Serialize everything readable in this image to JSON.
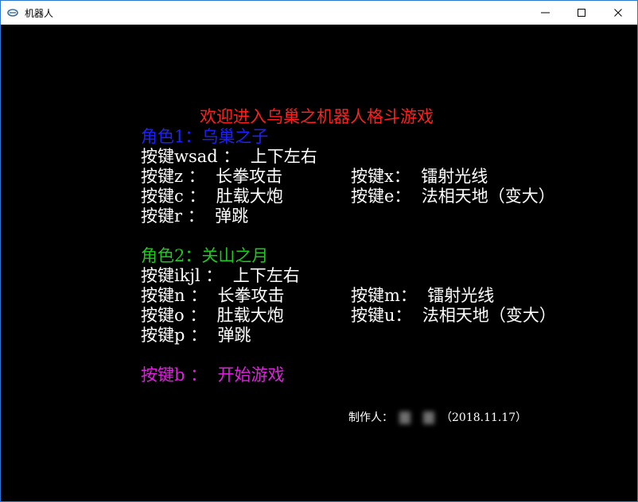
{
  "window": {
    "title": "机器人"
  },
  "console": {
    "title_line": "欢迎进入乌巢之机器人格斗游戏",
    "p1": {
      "name": "角色1：乌巢之子",
      "rows": [
        [
          "按键wsad ：  上下左右",
          ""
        ],
        [
          "按键z ：  长拳攻击",
          "按键x：  镭射光线"
        ],
        [
          "按键c ：  肚载大炮",
          "按键e：  法相天地（变大）"
        ],
        [
          "按键r ：  弹跳",
          ""
        ]
      ]
    },
    "p2": {
      "name": "角色2：关山之月",
      "rows": [
        [
          "按键ikjl ：  上下左右",
          ""
        ],
        [
          "按键n ：  长拳攻击",
          "按键m：  镭射光线"
        ],
        [
          "按键o ：  肚载大炮",
          "按键u：  法相天地（变大）"
        ],
        [
          "按键p ：  弹跳",
          ""
        ]
      ]
    },
    "start_line": "按键b ：  开始游戏",
    "credit": {
      "label": "制作人：",
      "date": "（2018.11.17）"
    }
  },
  "colors": {
    "title": "#ff1f1f",
    "p1": "#1e20ff",
    "p2": "#1ec81e",
    "start": "#e020e0",
    "text": "#ffffff"
  }
}
